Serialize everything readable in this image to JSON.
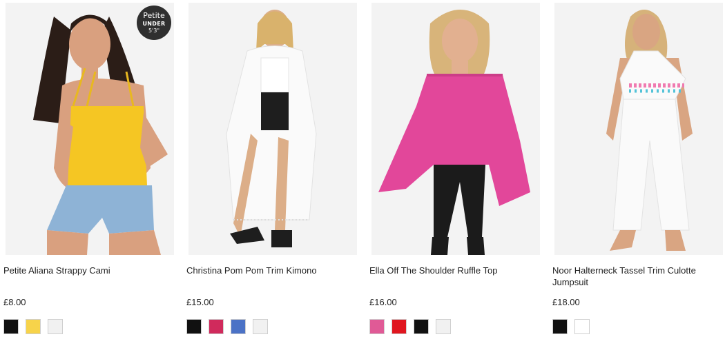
{
  "products": [
    {
      "name": "Petite Aliana Strappy Cami",
      "price": "£8.00",
      "badge": {
        "line1": "Petite",
        "line2": "UNDER",
        "line3": "5'3\""
      },
      "swatches": [
        "#111111",
        "#f7d34a",
        "#f1f1f1"
      ]
    },
    {
      "name": "Christina Pom Pom Trim Kimono",
      "price": "£15.00",
      "swatches": [
        "#111111",
        "#d02a5c",
        "#4b72c6",
        "#f1f1f1"
      ]
    },
    {
      "name": "Ella Off The Shoulder Ruffle Top",
      "price": "£16.00",
      "swatches": [
        "#e05a96",
        "#e0161f",
        "#111111",
        "#f1f1f1"
      ]
    },
    {
      "name": "Noor Halterneck Tassel Trim Culotte Jumpsuit",
      "price": "£18.00",
      "swatches": [
        "#111111",
        "#ffffff"
      ]
    }
  ]
}
